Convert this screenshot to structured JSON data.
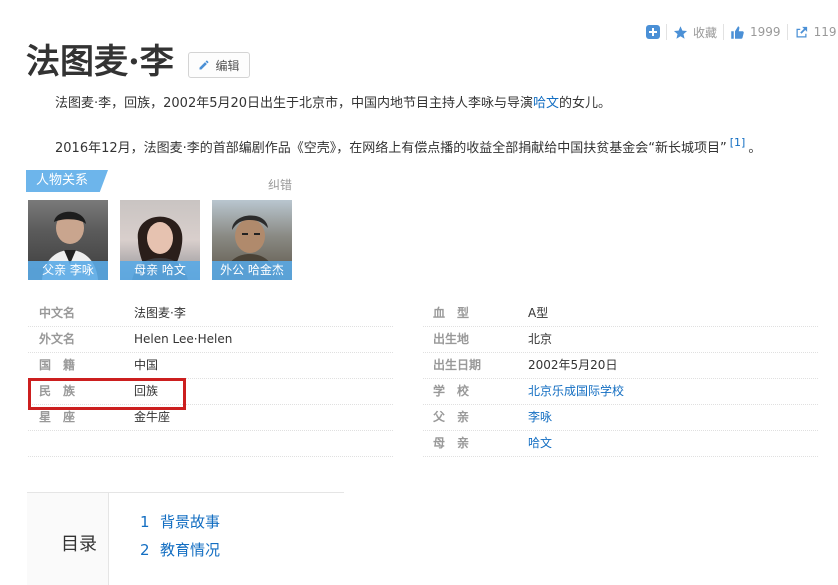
{
  "toolbar": {
    "add_icon": "plus-square-icon",
    "favorite_label": "收藏",
    "like_count": "1999",
    "share_count": "119"
  },
  "page": {
    "title": "法图麦·李",
    "edit_label": "编辑"
  },
  "summary": {
    "p1_before": "法图麦·李，回族，2002年5月20日出生于北京市，中国内地节目主持人李咏与导演",
    "p1_link": "哈文",
    "p1_after": "的女儿。",
    "p2_text": "2016年12月，法图麦·李的首部编剧作品《空壳》，在网络上有偿点播的收益全部捐献给中国扶贫基金会“新长城项目”",
    "p2_ref": "[1]",
    "p2_end": "。"
  },
  "relations": {
    "tag": "人物关系",
    "correct_label": "纠错",
    "people": [
      {
        "caption": "父亲 李咏"
      },
      {
        "caption": "母亲 哈文"
      },
      {
        "caption": "外公 哈金杰"
      }
    ]
  },
  "info": {
    "left": [
      {
        "label": "中文名",
        "value": "法图麦·李"
      },
      {
        "label": "外文名",
        "value": "Helen Lee·Helen"
      },
      {
        "label": "国　籍",
        "value": "中国"
      },
      {
        "label": "民　族",
        "value": "回族"
      },
      {
        "label": "星　座",
        "value": "金牛座"
      }
    ],
    "right": [
      {
        "label": "血　型",
        "value": "A型"
      },
      {
        "label": "出生地",
        "value": "北京"
      },
      {
        "label": "出生日期",
        "value": "2002年5月20日"
      },
      {
        "label": "学　校",
        "value": "北京乐成国际学校"
      },
      {
        "label": "父　亲",
        "value": "李咏"
      },
      {
        "label": "母　亲",
        "value": "哈文"
      }
    ]
  },
  "catalog": {
    "title": "目录",
    "items": [
      {
        "num": "1",
        "label": "背景故事"
      },
      {
        "num": "2",
        "label": "教育情况"
      }
    ]
  },
  "colors": {
    "link": "#136ec2",
    "accent_tag": "#6db5eb",
    "highlight": "#cc1f1f"
  }
}
